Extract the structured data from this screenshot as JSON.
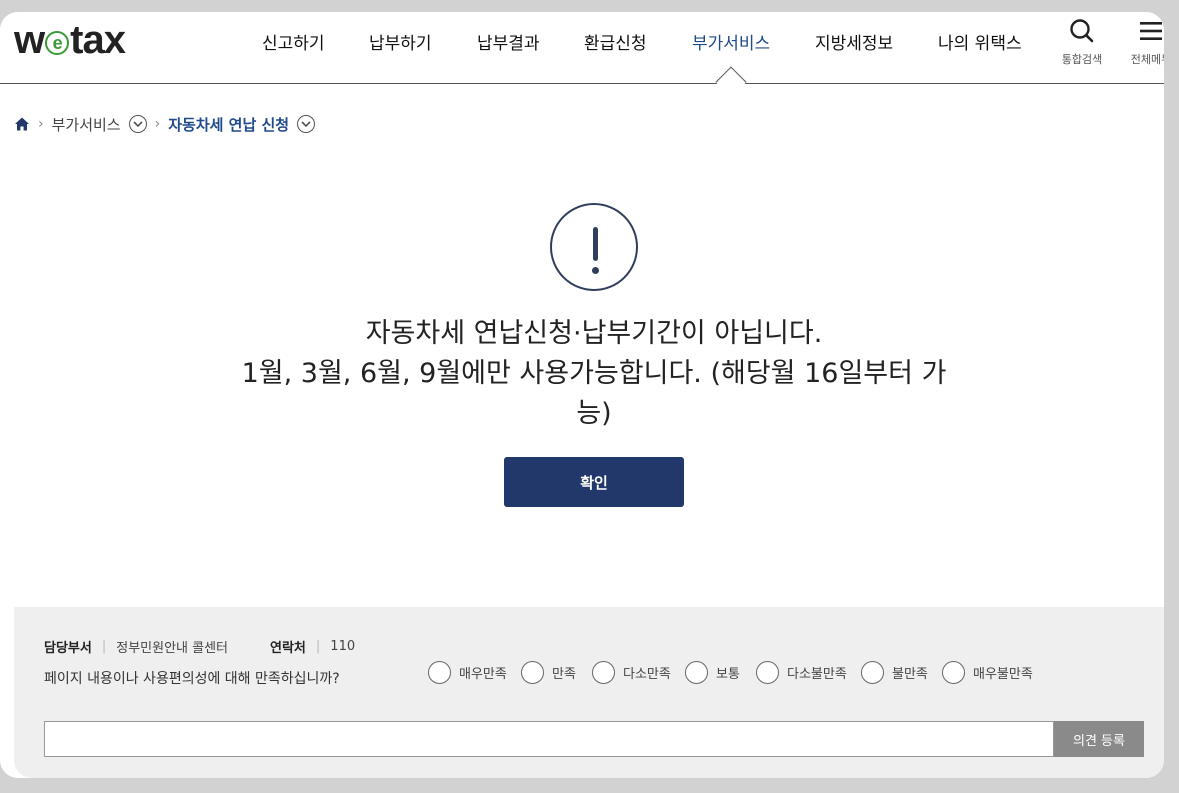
{
  "header": {
    "logo_text_left": "w",
    "logo_text_e": "e",
    "logo_text_right": "tax",
    "nav": [
      {
        "label": "신고하기",
        "active": false
      },
      {
        "label": "납부하기",
        "active": false
      },
      {
        "label": "납부결과",
        "active": false
      },
      {
        "label": "환급신청",
        "active": false
      },
      {
        "label": "부가서비스",
        "active": true
      },
      {
        "label": "지방세정보",
        "active": false
      },
      {
        "label": "나의 위택스",
        "active": false
      }
    ],
    "search_label": "통합검색",
    "menu_label": "전체메뉴"
  },
  "breadcrumb": {
    "home_icon": "home-icon",
    "level1": "부가서비스",
    "current": "자동차세 연납 신청"
  },
  "alert": {
    "icon": "exclamation-icon",
    "line1": "자동차세 연납신청·납부기간이 아닙니다.",
    "line2": "1월, 3월, 6월, 9월에만 사용가능합니다. (해당월 16일부터 가능)",
    "confirm_label": "확인"
  },
  "survey": {
    "dept_label": "담당부서",
    "dept_value": "정부민원안내 콜센터",
    "contact_label": "연락처",
    "contact_value": "110",
    "question": "페이지 내용이나 사용편의성에 대해 만족하십니까?",
    "options": [
      "매우만족",
      "만족",
      "다소만족",
      "보통",
      "다소불만족",
      "불만족",
      "매우불만족"
    ],
    "submit_label": "의견 등록"
  },
  "colors": {
    "accent": "#1f4a8c",
    "button": "#22386a",
    "logo_green": "#3a9a3a"
  }
}
